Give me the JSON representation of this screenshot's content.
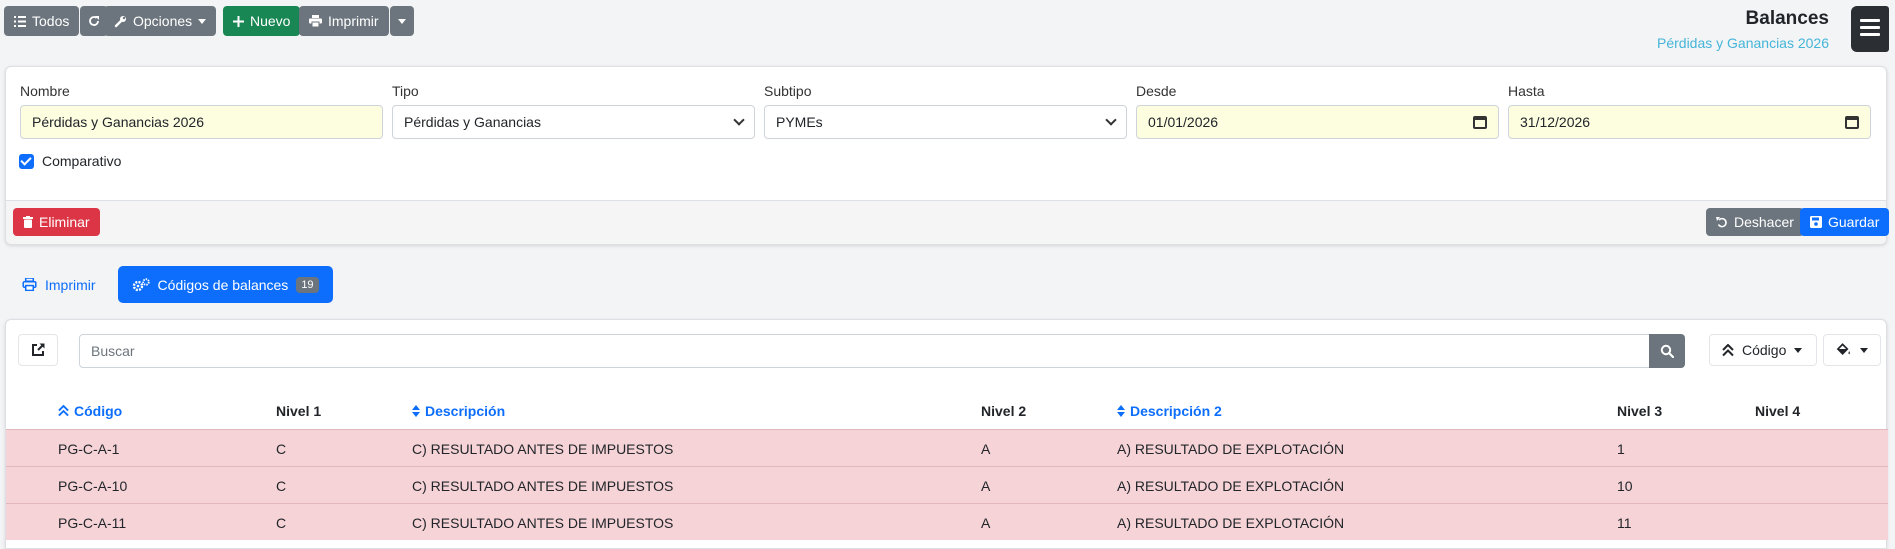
{
  "toolbar": {
    "todos_label": "Todos",
    "opciones_label": "Opciones",
    "nuevo_label": "Nuevo",
    "imprimir_label": "Imprimir"
  },
  "header": {
    "title": "Balances",
    "subtitle": "Pérdidas y Ganancias 2026"
  },
  "form": {
    "nombre_label": "Nombre",
    "nombre_value": "Pérdidas y Ganancias 2026",
    "tipo_label": "Tipo",
    "tipo_value": "Pérdidas y Ganancias",
    "subtipo_label": "Subtipo",
    "subtipo_value": "PYMEs",
    "desde_label": "Desde",
    "desde_value": "01/01/2026",
    "hasta_label": "Hasta",
    "hasta_value": "31/12/2026",
    "comparativo_label": "Comparativo",
    "comparativo_checked": true,
    "eliminar_label": "Eliminar",
    "deshacer_label": "Deshacer",
    "guardar_label": "Guardar"
  },
  "tabs": {
    "imprimir_label": "Imprimir",
    "codigos_label": "Códigos de balances",
    "codigos_count": "19"
  },
  "list": {
    "search_placeholder": "Buscar",
    "sort_label": "Código",
    "columns": {
      "codigo": "Código",
      "nivel1": "Nivel 1",
      "descripcion": "Descripción",
      "nivel2": "Nivel 2",
      "descripcion2": "Descripción 2",
      "nivel3": "Nivel 3",
      "nivel4": "Nivel 4"
    },
    "rows": [
      {
        "codigo": "PG-C-A-1",
        "nivel1": "C",
        "descripcion": "C) RESULTADO ANTES DE IMPUESTOS",
        "nivel2": "A",
        "descripcion2": "A) RESULTADO DE EXPLOTACIÓN",
        "nivel3": "1",
        "nivel4": ""
      },
      {
        "codigo": "PG-C-A-10",
        "nivel1": "C",
        "descripcion": "C) RESULTADO ANTES DE IMPUESTOS",
        "nivel2": "A",
        "descripcion2": "A) RESULTADO DE EXPLOTACIÓN",
        "nivel3": "10",
        "nivel4": ""
      },
      {
        "codigo": "PG-C-A-11",
        "nivel1": "C",
        "descripcion": "C) RESULTADO ANTES DE IMPUESTOS",
        "nivel2": "A",
        "descripcion2": "A) RESULTADO DE EXPLOTACIÓN",
        "nivel3": "11",
        "nivel4": ""
      }
    ]
  },
  "colors": {
    "primary": "#0d6efd",
    "success": "#198754",
    "danger": "#dc3545",
    "secondary": "#6c757d",
    "row_highlight": "#f5d3d7",
    "subtitle": "#45b5d8"
  }
}
